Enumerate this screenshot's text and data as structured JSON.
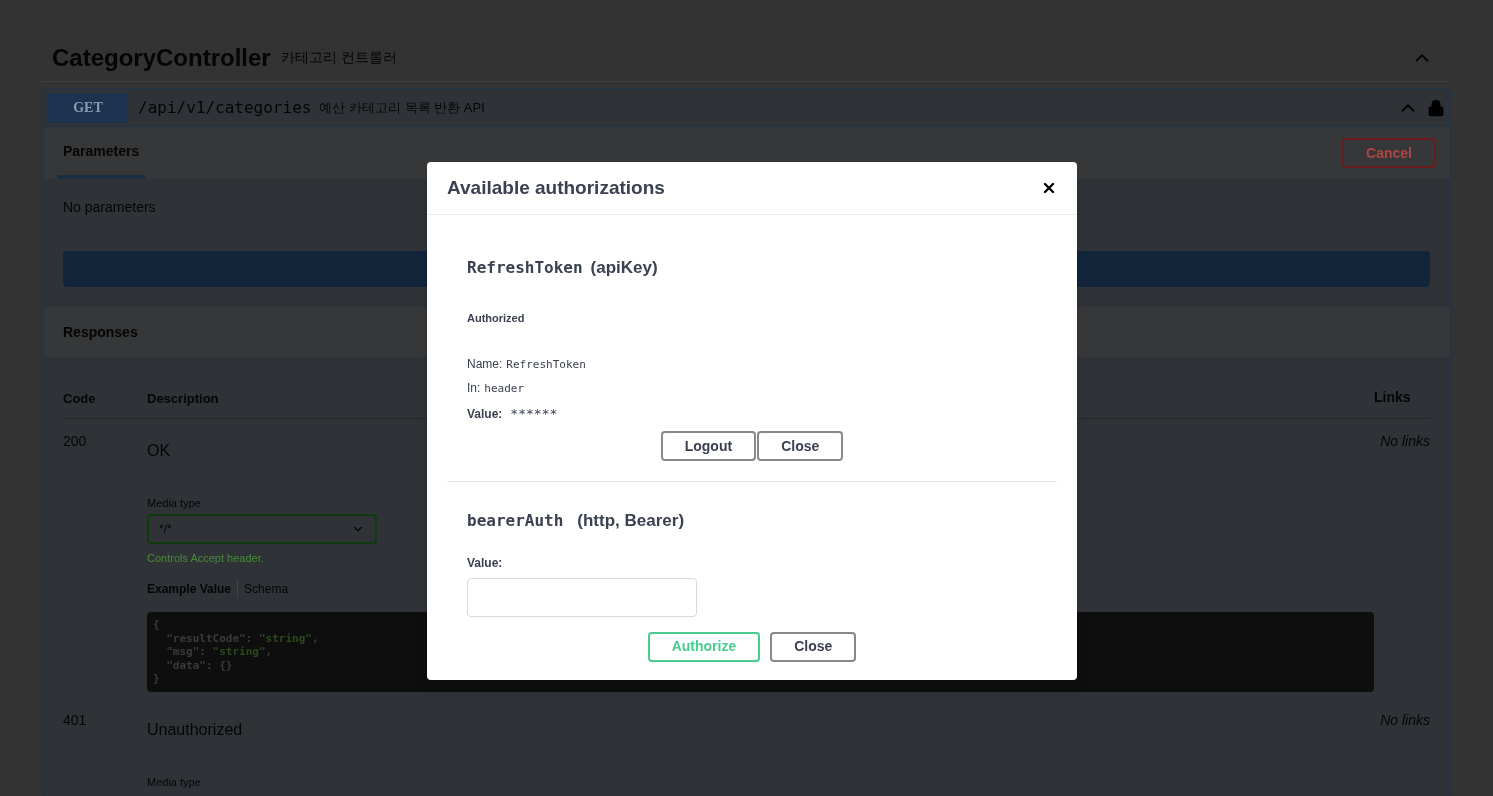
{
  "section": {
    "title": "CategoryController",
    "description": "카테고리 컨트롤러",
    "expanded": true
  },
  "operation": {
    "method": "GET",
    "path": "/api/v1/categories",
    "summary": "예산 카테고리 목록 반환 API",
    "expanded": true,
    "locked": true
  },
  "tabs": [
    {
      "label": "Parameters",
      "selected": true
    }
  ],
  "cancel_button": "Cancel",
  "parameters_text": "No parameters",
  "responses_title": "Responses",
  "response_columns": [
    "Code",
    "Description",
    "Links"
  ],
  "responses": [
    {
      "code": "200",
      "description": "OK",
      "links": "No links",
      "media_type_label": "Media type",
      "media_type": "*/*",
      "media_hint": "Controls Accept header.",
      "example_tabs": [
        {
          "label": "Example Value",
          "selected": true
        },
        {
          "label": "Schema",
          "selected": false
        }
      ],
      "example": [
        [
          {
            "kind": "punct",
            "text": "{"
          }
        ],
        [
          {
            "kind": "key",
            "text": "  \"resultCode\""
          },
          {
            "kind": "punct",
            "text": ": "
          },
          {
            "kind": "string",
            "text": "\"string\""
          },
          {
            "kind": "punct",
            "text": ","
          }
        ],
        [
          {
            "kind": "key",
            "text": "  \"msg\""
          },
          {
            "kind": "punct",
            "text": ": "
          },
          {
            "kind": "string",
            "text": "\"string\""
          },
          {
            "kind": "punct",
            "text": ","
          }
        ],
        [
          {
            "kind": "key",
            "text": "  \"data\""
          },
          {
            "kind": "punct",
            "text": ": {}"
          }
        ],
        [
          {
            "kind": "punct",
            "text": "}"
          }
        ]
      ]
    },
    {
      "code": "401",
      "description": "Unauthorized",
      "links": "No links",
      "media_type_label": "Media type"
    }
  ],
  "dialog": {
    "title": "Available authorizations",
    "schemes": [
      {
        "kind": "apikey",
        "name": "RefreshToken",
        "type": "(apiKey)",
        "status": "Authorized",
        "fields": [
          {
            "label": "Name:",
            "value": "RefreshToken"
          },
          {
            "label": "In:",
            "value": "header"
          }
        ],
        "value_label": "Value:",
        "value": "******",
        "buttons": [
          {
            "label": "Logout",
            "kind": "secondary"
          },
          {
            "label": "Close",
            "kind": "secondary"
          }
        ]
      },
      {
        "kind": "http",
        "name": "bearerAuth",
        "type": "(http, Bearer)",
        "value_label": "Value:",
        "buttons": [
          {
            "label": "Authorize",
            "kind": "authorize"
          },
          {
            "label": "Close",
            "kind": "secondary"
          }
        ]
      }
    ]
  }
}
